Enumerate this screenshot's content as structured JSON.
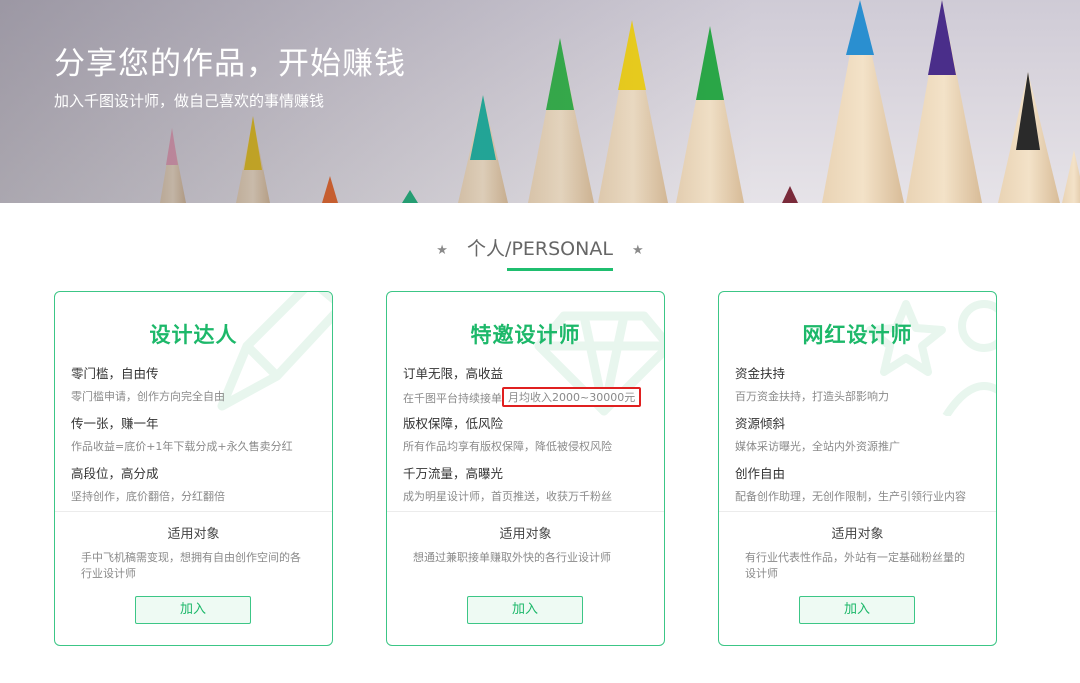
{
  "hero": {
    "title": "分享您的作品，开始赚钱",
    "subtitle": "加入千图设计师，做自己喜欢的事情赚钱"
  },
  "section": {
    "title": "个人/PERSONAL",
    "star_icon": "star-icon"
  },
  "cards": [
    {
      "title": "设计达人",
      "features": [
        {
          "title": "零门槛，自由传",
          "desc": "零门槛申请，创作方向完全自由"
        },
        {
          "title": "传一张，赚一年",
          "desc": "作品收益=底价+1年下载分成+永久售卖分红"
        },
        {
          "title": "高段位，高分成",
          "desc": "坚持创作，底价翻倍，分红翻倍"
        }
      ],
      "audience_label": "适用对象",
      "audience_desc": "手中飞机稿需变现，想拥有自由创作空间的各行业设计师",
      "button": "加入"
    },
    {
      "title": "特邀设计师",
      "features": [
        {
          "title": "订单无限，高收益",
          "desc": "在千图平台持续接单",
          "highlight": "月均收入2000~30000元"
        },
        {
          "title": "版权保障，低风险",
          "desc": "所有作品均享有版权保障，降低被侵权风险"
        },
        {
          "title": "千万流量，高曝光",
          "desc": "成为明星设计师，首页推送，收获万千粉丝"
        }
      ],
      "audience_label": "适用对象",
      "audience_desc": "想通过兼职接单赚取外快的各行业设计师",
      "button": "加入"
    },
    {
      "title": "网红设计师",
      "features": [
        {
          "title": "资金扶持",
          "desc": "百万资金扶持，打造头部影响力"
        },
        {
          "title": "资源倾斜",
          "desc": "媒体采访曝光，全站内外资源推广"
        },
        {
          "title": "创作自由",
          "desc": "配备创作助理，无创作限制，生产引领行业内容"
        }
      ],
      "audience_label": "适用对象",
      "audience_desc": "有行业代表性作品，外站有一定基础粉丝量的设计师",
      "button": "加入"
    }
  ],
  "colors": {
    "accent": "#1db86a",
    "border": "#3cc686",
    "highlight_box": "#e02020"
  }
}
